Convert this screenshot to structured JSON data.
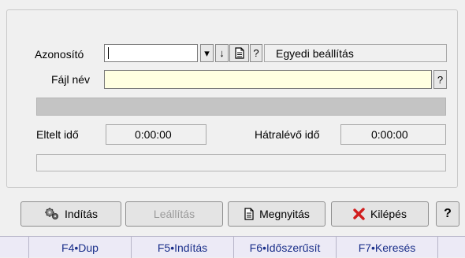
{
  "form": {
    "azonosito_label": "Azonosító",
    "azonosito_value": "",
    "dropdown_glyph": "▾",
    "sort_glyph": "↓",
    "help_glyph": "?",
    "egyedi_label": "Egyedi beállítás",
    "fajl_nev_label": "Fájl név",
    "fajl_nev_value": "",
    "eltelt_ido_label": "Eltelt idő",
    "eltelt_ido_value": "0:00:00",
    "hatralevo_ido_label": "Hátralévő idő",
    "hatralevo_ido_value": "0:00:00"
  },
  "buttons": {
    "inditas": "Indítás",
    "leallitas": "Leállítás",
    "megnyitas": "Megnyitás",
    "kilepes": "Kilépés",
    "help": "?"
  },
  "function_keys": [
    "F4•Dup",
    "F5•Indítás",
    "F6•Időszerűsít",
    "F7•Keresés"
  ],
  "colors": {
    "file_field_bg": "#ffffe1",
    "progress_bar": "#c4c4c4",
    "kilepes_icon": "#d11d1d",
    "fkey_text": "#1a2f8a"
  },
  "progress": {
    "file_progress": 0,
    "overall_progress": 0
  }
}
